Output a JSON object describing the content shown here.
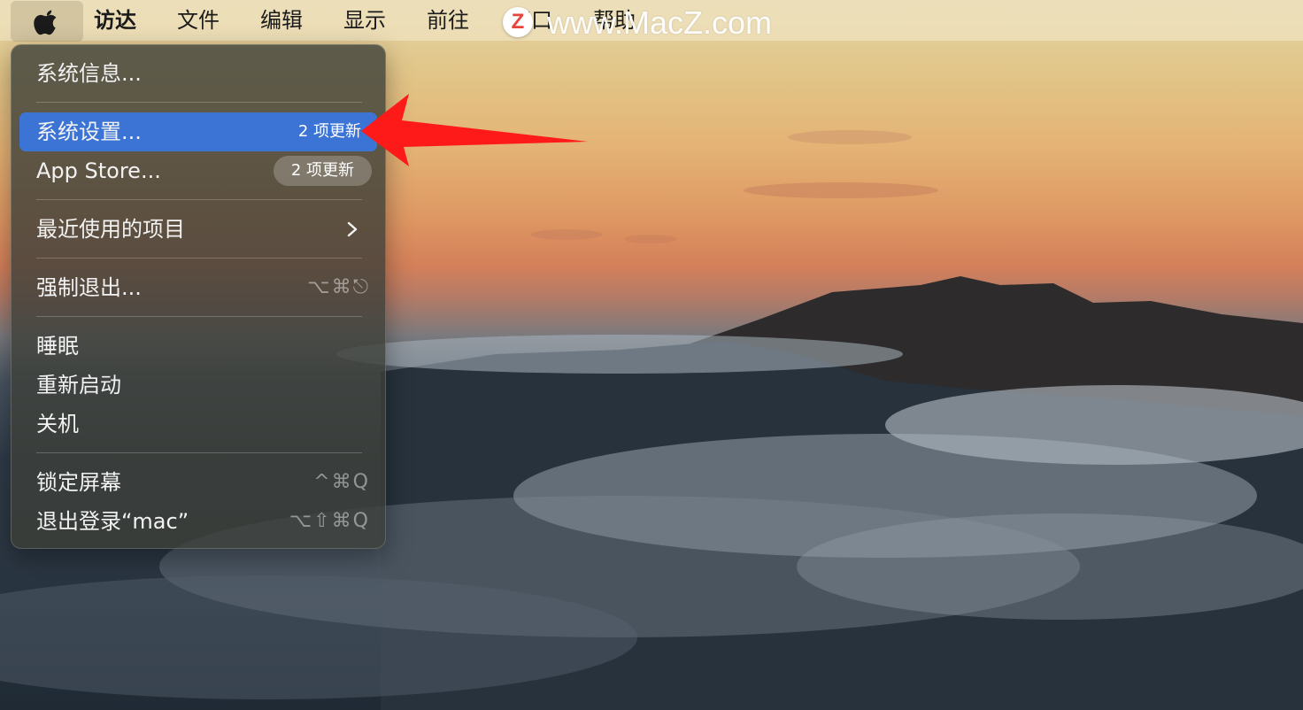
{
  "menubar": {
    "app_name": "访达",
    "items": [
      "文件",
      "编辑",
      "显示",
      "前往",
      "窗口",
      "帮助"
    ]
  },
  "watermark": {
    "logo": "Z",
    "text": "www.MacZ.com"
  },
  "apple_menu": {
    "about": "系统信息...",
    "system_settings": {
      "label": "系统设置...",
      "badge": "2 项更新"
    },
    "app_store": {
      "label": "App Store...",
      "badge": "2 项更新"
    },
    "recent_items": "最近使用的项目",
    "force_quit": {
      "label": "强制退出...",
      "shortcut": "⌥⌘⎋"
    },
    "sleep": "睡眠",
    "restart": "重新启动",
    "shutdown": "关机",
    "lock_screen": {
      "label": "锁定屏幕",
      "shortcut": "^⌘Q"
    },
    "logout": {
      "label": "退出登录“mac”",
      "shortcut": "⌥⇧⌘Q"
    }
  },
  "colors": {
    "highlight": "#3c74d6",
    "arrow": "#ff1a1a"
  },
  "icons": {
    "apple": "apple-logo-icon",
    "chevron": "chevron-right-icon",
    "arrow": "red-annotation-arrow"
  }
}
